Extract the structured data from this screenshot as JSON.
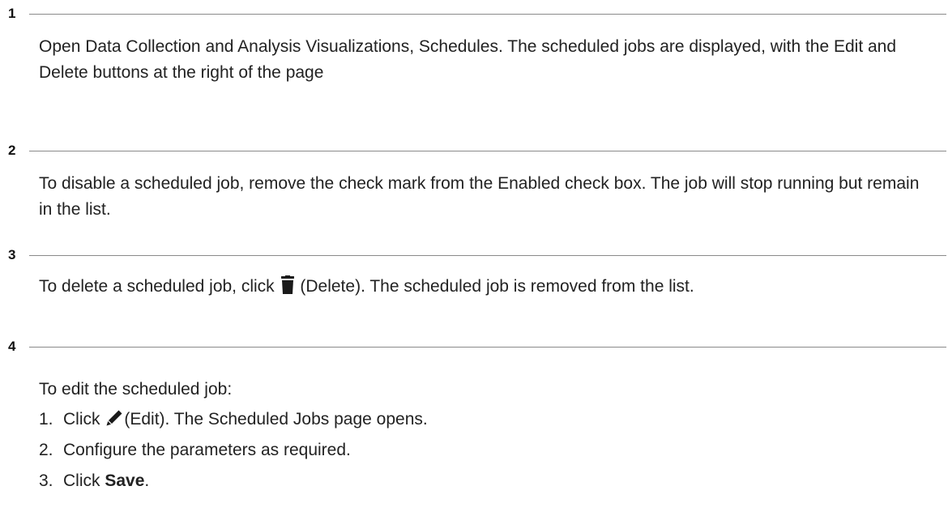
{
  "steps": [
    {
      "number": "1",
      "text": "Open Data Collection and Analysis Visualizations, Schedules. The scheduled jobs are displayed, with the Edit and Delete buttons at the right of the page"
    },
    {
      "number": "2",
      "text": "To disable a scheduled job, remove the check mark from the Enabled check box. The job will stop running but remain in the list."
    },
    {
      "number": "3",
      "text_before": "To delete a scheduled job, click",
      "icon": "trash-icon",
      "text_after": "(Delete). The scheduled job is removed from the list."
    },
    {
      "number": "4",
      "intro": "To edit the scheduled job:",
      "substeps": [
        {
          "number": "1.",
          "text_before": "Click",
          "icon": "pencil-icon",
          "text_after": "(Edit). The Scheduled Jobs page opens."
        },
        {
          "number": "2.",
          "text": "Configure the parameters as required."
        },
        {
          "number": "3.",
          "text_before": "Click",
          "bold": "Save",
          "text_after": "."
        }
      ]
    }
  ]
}
